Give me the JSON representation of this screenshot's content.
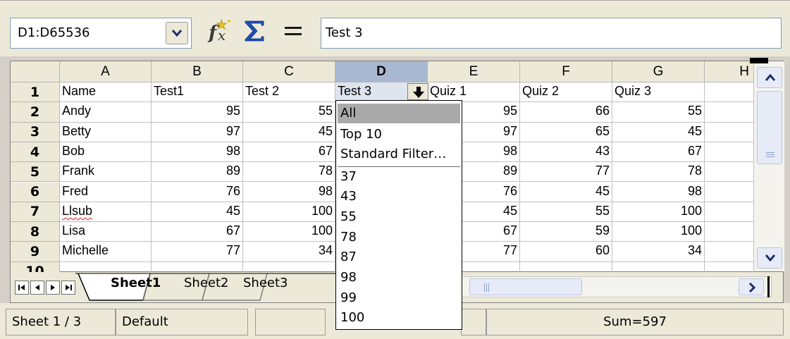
{
  "formula_bar": {
    "name_box": "D1:D65536",
    "input_line": "Test 3"
  },
  "grid": {
    "column_headers": [
      "A",
      "B",
      "C",
      "D",
      "E",
      "F",
      "G",
      "H"
    ],
    "row_headers": [
      "1",
      "2",
      "3",
      "4",
      "5",
      "6",
      "7",
      "8",
      "9",
      "10"
    ],
    "rows": [
      [
        "Name",
        "Test1",
        "Test 2",
        "Test 3",
        "Quiz 1",
        "Quiz 2",
        "Quiz 3"
      ],
      [
        "Andy",
        "95",
        "55",
        "",
        "95",
        "66",
        "55"
      ],
      [
        "Betty",
        "97",
        "45",
        "",
        "97",
        "65",
        "45"
      ],
      [
        "Bob",
        "98",
        "67",
        "",
        "98",
        "43",
        "67"
      ],
      [
        "Frank",
        "89",
        "78",
        "",
        "89",
        "77",
        "78"
      ],
      [
        "Fred",
        "76",
        "98",
        "",
        "76",
        "45",
        "98"
      ],
      [
        "Llsub",
        "45",
        "100",
        "",
        "45",
        "55",
        "100"
      ],
      [
        "Lisa",
        "67",
        "100",
        "",
        "67",
        "59",
        "100"
      ],
      [
        "Michelle",
        "77",
        "34",
        "",
        "77",
        "60",
        "34"
      ],
      [
        "",
        "",
        "",
        "",
        "",
        "",
        ""
      ]
    ]
  },
  "filter_dropdown": {
    "items": [
      "All",
      "Top 10",
      "Standard Filter…",
      "37",
      "43",
      "55",
      "78",
      "87",
      "98",
      "99",
      "100"
    ],
    "selected": "All"
  },
  "sheet_tabs": [
    "Sheet1",
    "Sheet2",
    "Sheet3"
  ],
  "active_sheet": "Sheet1",
  "status_bar": {
    "sheet_position": "Sheet 1 / 3",
    "page_style": "Default",
    "sum": "Sum=597"
  },
  "icons": {
    "name_box_dropdown": "chevron-down-icon",
    "function_wizard": "fx-wand-icon",
    "sum": "sigma-icon",
    "function": "equals-icon",
    "autofilter": "arrow-down-icon",
    "nav_first": "first-sheet-icon",
    "nav_prev": "prev-sheet-icon",
    "nav_next": "next-sheet-icon",
    "nav_last": "last-sheet-icon"
  },
  "colors": {
    "selected_column_header": "#a9b8d2",
    "selected_cells": "#dfe5ef",
    "dropdown_highlight": "#a9a9a9",
    "sum_icon": "#1f4fb5",
    "spellcheck_underline": "#e02020"
  }
}
